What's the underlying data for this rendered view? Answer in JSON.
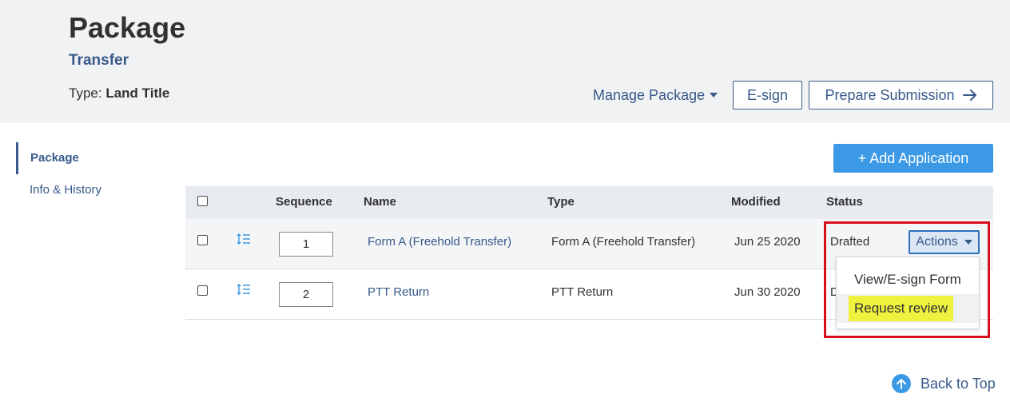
{
  "header": {
    "title": "Package",
    "subtitle": "Transfer",
    "type_label": "Type:",
    "type_value": "Land Title",
    "manage_label": "Manage Package",
    "esign_label": "E-sign",
    "prepare_label": "Prepare Submission"
  },
  "sidebar": {
    "items": [
      {
        "label": "Package",
        "active": true
      },
      {
        "label": "Info & History",
        "active": false
      }
    ]
  },
  "add_application_label": "+ Add Application",
  "table": {
    "columns": [
      "Sequence",
      "Name",
      "Type",
      "Modified",
      "Status"
    ],
    "rows": [
      {
        "sequence": "1",
        "name": "Form A (Freehold Transfer)",
        "type": "Form A (Freehold Transfer)",
        "modified": "Jun 25 2020",
        "status": "Drafted"
      },
      {
        "sequence": "2",
        "name": "PTT Return",
        "type": "PTT Return",
        "modified": "Jun 30 2020",
        "status": "D"
      }
    ]
  },
  "actions": {
    "label": "Actions",
    "menu": [
      "View/E-sign Form",
      "Request review"
    ]
  },
  "back_to_top": "Back to Top",
  "colors": {
    "brand_blue": "#38598a",
    "accent_blue": "#3b99e6",
    "highlight": "#eef23e",
    "annotation_red": "#d8101b"
  }
}
